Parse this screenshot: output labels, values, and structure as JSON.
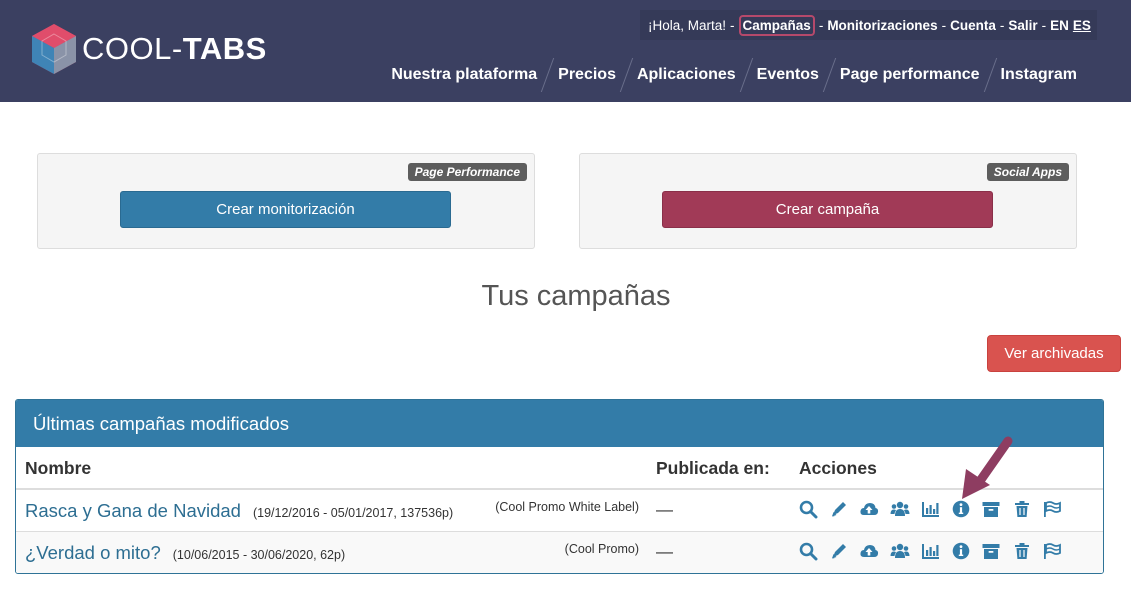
{
  "brand": {
    "logo_text_light": "COOL-",
    "logo_text_bold": "TABS",
    "accent": "#3b4061"
  },
  "userbar": {
    "greeting": "¡Hola, Marta!",
    "links": [
      "Campañas",
      "Monitorizaciones",
      "Cuenta",
      "Salir"
    ],
    "lang_en": "EN",
    "lang_es": "ES",
    "active_link": "Campañas"
  },
  "nav": [
    "Nuestra plataforma",
    "Precios",
    "Aplicaciones",
    "Eventos",
    "Page performance",
    "Instagram"
  ],
  "panels": {
    "left": {
      "tag": "Page Performance",
      "button": "Crear monitorización"
    },
    "right": {
      "tag": "Social Apps",
      "button": "Crear campaña"
    }
  },
  "section_title": "Tus campañas",
  "archived_button": "Ver archivadas",
  "table": {
    "heading": "Últimas campañas modificados",
    "columns": [
      "Nombre",
      "Publicada en:",
      "Acciones"
    ],
    "rows": [
      {
        "name": "Rasca y Gana de Navidad",
        "meta": "(19/12/2016 - 05/01/2017, 137536p)",
        "product": "(Cool Promo White Label)",
        "published": "—"
      },
      {
        "name": "¿Verdad o mito?",
        "meta": "(10/06/2015 - 30/06/2020, 62p)",
        "product": "(Cool Promo)",
        "published": "—"
      }
    ],
    "action_icons": [
      "search-icon",
      "pencil-icon",
      "cloud-upload-icon",
      "users-icon",
      "bar-chart-icon",
      "info-icon",
      "archive-icon",
      "trash-icon",
      "flag-icon"
    ]
  },
  "colors": {
    "primary": "#337ca8",
    "maroon": "#a13a57",
    "danger": "#d9534f",
    "arrow": "#8e3d61"
  }
}
